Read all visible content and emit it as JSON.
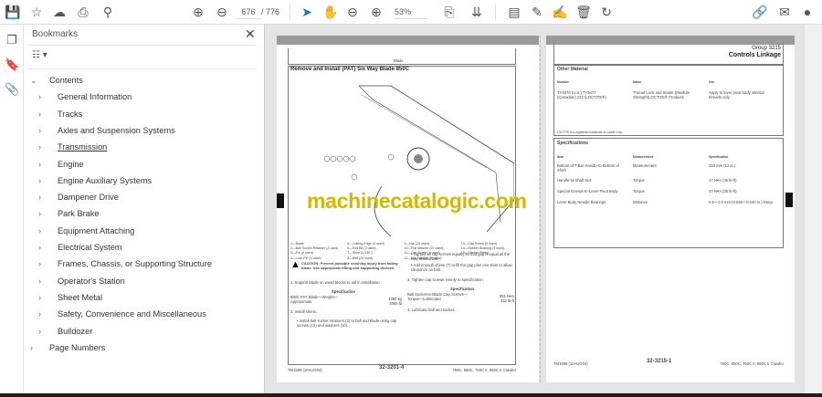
{
  "toolbar": {
    "page_current": "676",
    "page_total": "/ 776",
    "zoom": "53%",
    "icons": [
      "save-icon",
      "star-icon",
      "upload-icon",
      "print-icon",
      "search-zoom-icon",
      "page-up-icon",
      "page-down-icon",
      "select-arrow-icon",
      "hand-icon",
      "zoom-out-icon",
      "zoom-in-icon",
      "page-fit-icon",
      "scroll-mode-icon",
      "comment-icon",
      "pen-icon",
      "sign-icon",
      "delete-icon",
      "rotate-icon",
      "share-link-icon",
      "mail-icon",
      "account-icon"
    ]
  },
  "rail": {
    "icons": [
      "pages-icon",
      "bookmark-icon",
      "attachment-icon"
    ]
  },
  "bookmarks": {
    "title": "Bookmarks",
    "items": [
      {
        "label": "Contents",
        "level": 1,
        "expanded": true
      },
      {
        "label": "General Information",
        "level": 2
      },
      {
        "label": "Tracks",
        "level": 2
      },
      {
        "label": "Axles and Suspension Systems",
        "level": 2
      },
      {
        "label": "Transmission",
        "level": 2,
        "underlined": true
      },
      {
        "label": "Engine",
        "level": 2
      },
      {
        "label": "Engine Auxiliary Systems",
        "level": 2
      },
      {
        "label": "Dampener Drive",
        "level": 2
      },
      {
        "label": "Park Brake",
        "level": 2
      },
      {
        "label": "Equipment Attaching",
        "level": 2
      },
      {
        "label": "Electrical System",
        "level": 2
      },
      {
        "label": "Frames, Chassis, or Supporting Structure",
        "level": 2
      },
      {
        "label": "Operator's Station",
        "level": 2
      },
      {
        "label": "Sheet Metal",
        "level": 2
      },
      {
        "label": "Safety, Convenience and Miscellaneous",
        "level": 2
      },
      {
        "label": "Bulldozer",
        "level": 2
      },
      {
        "label": "Page Numbers",
        "level": 1
      }
    ]
  },
  "left_page": {
    "header": "Blade",
    "title": "Remove and Install (PAT) Six Way Blade 850C",
    "legend": [
      "1—Blade",
      "2—Ball Socket Retainer (2 used)",
      "3—Pin (4 used)",
      "4—Lock Pin (4 used)",
      "5—Cutting Edge (3 used)",
      "6—End Bit (2 used)",
      "7—Shim (0.030\")",
      "8—Bolt (26 used)",
      "9—Nut (24 used)",
      "10—Flat Washer (22 used)",
      "11—Cap Screw (4 used)",
      "12—Flat Washer (4 used)",
      "13—Cap Screw (4 used)",
      "14—Rubber Bushing (4 used)",
      "15—Grease Fitting"
    ],
    "caution": "CAUTION: Prevent possible crushing injury from falling blade. Use appropriate lifting and supporting devices.",
    "step1": "1.  Support blade on wood blocks to aid in installation.",
    "spec_label": "Specification",
    "spec1_item": "850C PAT Blade—Weight—Approximate",
    "spec1_value": "1390 kg  3065 lb",
    "step2": "2.  Install shims.",
    "bullet1": "•  Install ball socket retainers (2) to ball and blade using cap screws (13) and washers (10).",
    "bullet2": "•  Tighten all cap screws equally so that gap is equal all the way around ball.",
    "bullet3": "•  Add enough shims (7) to fill the gap plus one shim to allow clearance on ball.",
    "step3": "3.  Tighten cap screws evenly to specification.",
    "spec2_item": "Ball Socket-to-Blade Cap Screws—Torque—Lubricated",
    "spec2_value": "881 N•m  312 lb-ft",
    "step4": "4.  Lubricate ball and socket.",
    "footer_left": "TM1589 (10AUG04)",
    "footer_center": "32-3201-4",
    "footer_right": "750C, 850C, 750C II, 850C II Crawler"
  },
  "right_page": {
    "group": "Group 3215",
    "title": "Controls Linkage",
    "other_material": {
      "title": "Other Material",
      "headers": [
        "Number",
        "Name",
        "Use"
      ],
      "row": [
        "TY9370 (U.S.) TY9477 (Canadian) 242 (LOCTITE®)",
        "Thread Lock and Sealer (Medium Strength)LOCTITE® Products",
        "Apply to lever pivot body internal threads only."
      ],
      "note": "LOCTITE is a registered trademark of Loctite Corp."
    },
    "specifications": {
      "title": "Specifications",
      "headers": [
        "Item",
        "Measurement",
        "Specification"
      ],
      "rows": [
        [
          "Bottom of T-Bar Handle-to-Bottom of Shaft",
          "Measurement",
          "310 mm (12 in.)"
        ],
        [
          "Handle-to-Shaft Nut",
          "Torque",
          "47 N•m (35 lb-ft)"
        ],
        [
          "Special Screws-to-Lever Pivot Body",
          "Torque",
          "47 N•m (35 lb-ft)"
        ],
        [
          "Lever Body Needle Bearings",
          "Distance",
          "0.5—1.0 mm (0.020—0.040 in.) Deep"
        ]
      ]
    },
    "footer_left": "TM1589 (10AUG04)",
    "footer_center": "32-3215-1",
    "footer_right": "750C, 850C, 750C II, 850C II Crawler"
  },
  "watermark": "machinecatalogic.com"
}
